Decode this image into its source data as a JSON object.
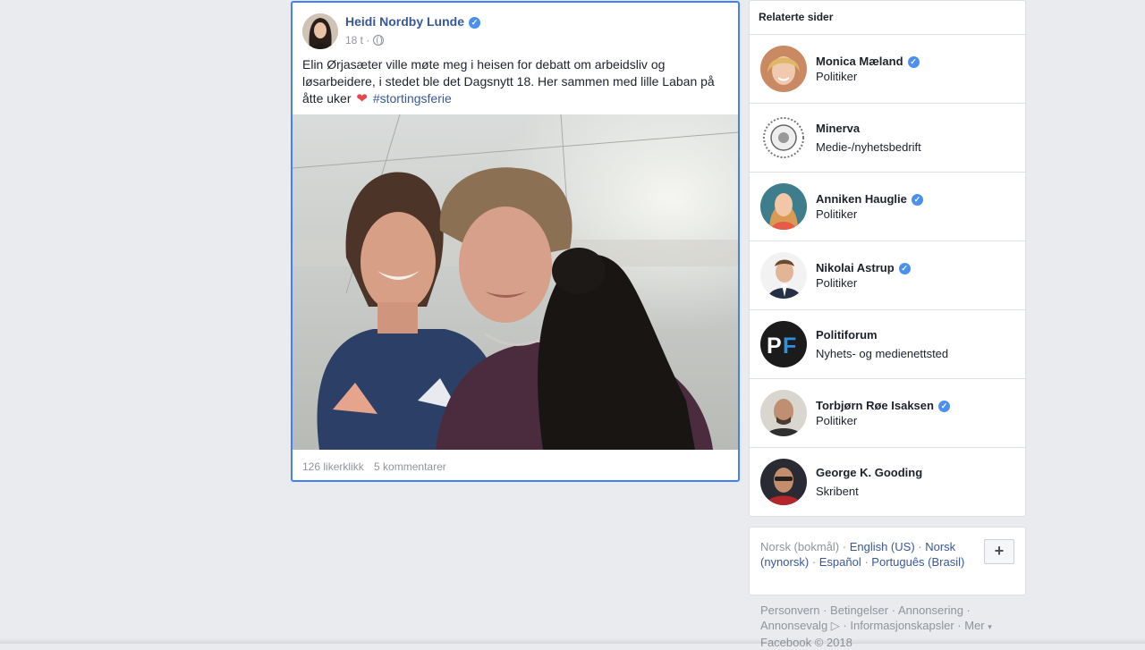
{
  "post": {
    "author": "Heidi Nordby Lunde",
    "time": "18 t",
    "meta_sep": " ·",
    "text": "Elin Ørjasæter ville møte meg i heisen for debatt om arbeidsliv og løsarbeidere, i stedet ble det Dagsnytt 18. Her sammen med lille Laban på åtte uker",
    "heart": "❤",
    "hashtag": "#stortingsferie",
    "likes": "126 likerklikk",
    "comments": "5 kommentarer"
  },
  "related": {
    "title": "Relaterte sider",
    "items": [
      {
        "name": "Monica Mæland",
        "category": "Politiker",
        "verified": true
      },
      {
        "name": "Minerva",
        "category": "Medie-/nyhetsbedrift",
        "verified": false
      },
      {
        "name": "Anniken Hauglie",
        "category": "Politiker",
        "verified": true
      },
      {
        "name": "Nikolai Astrup",
        "category": "Politiker",
        "verified": true
      },
      {
        "name": "Politiforum",
        "category": "Nyhets- og medienettsted",
        "verified": false
      },
      {
        "name": "Torbjørn Røe Isaksen",
        "category": "Politiker",
        "verified": true
      },
      {
        "name": "George K. Gooding",
        "category": "Skribent",
        "verified": false
      }
    ]
  },
  "languages": {
    "current": "Norsk (bokmål)",
    "options": [
      "English (US)",
      "Norsk (nynorsk)",
      "Español",
      "Português (Brasil)"
    ],
    "add_label": "+"
  },
  "footer": {
    "links": [
      "Personvern",
      "Betingelser",
      "Annonsering",
      "Annonsevalg",
      "Informasjonskapsler",
      "Mer"
    ],
    "copyright": "Facebook © 2018"
  },
  "colors": {
    "link": "#385898",
    "verified": "#4b8ff0",
    "background": "#e9ebee",
    "focus_border": "#4080ff"
  },
  "icons": {
    "verified": "verified-check-icon",
    "privacy": "globe-icon",
    "heart": "heart-icon",
    "adchoices": "adchoices-icon",
    "more": "chevron-down-icon"
  }
}
